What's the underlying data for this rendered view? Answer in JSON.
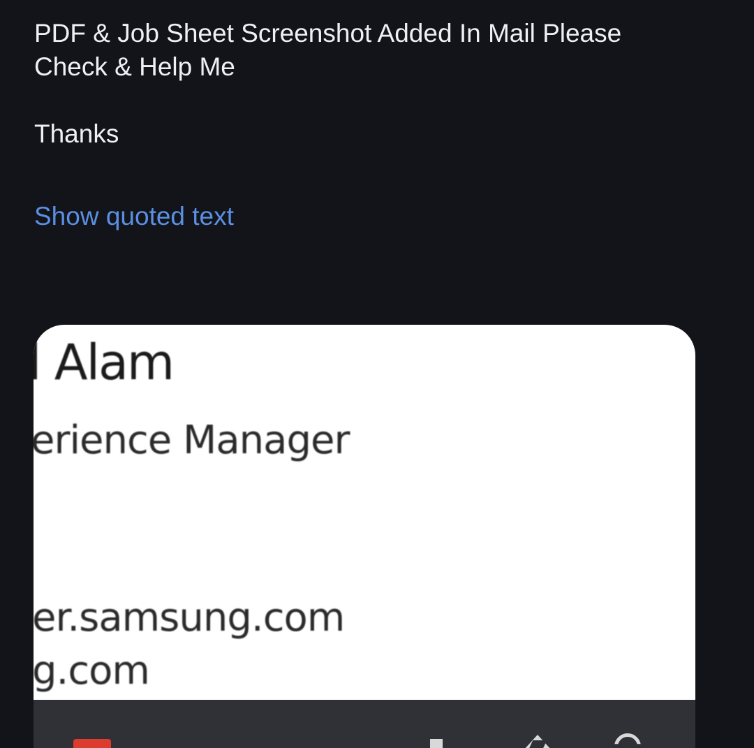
{
  "message": {
    "body_line_1": "PDF & Job Sheet Screenshot Added In Mail Please",
    "body_line_2": "Check & Help Me",
    "signoff": "Thanks",
    "show_quoted_text": "Show quoted text"
  },
  "attachment_preview": {
    "name_fragment": "l Alam",
    "title_fragment": "erience Manager",
    "website_fragment": "er.samsung.com",
    "email_fragment": "g.com"
  },
  "attachment_actions": {
    "file_icon": "pdf-file-icon",
    "download_icon": "download-icon",
    "drive_icon": "drive-icon",
    "photos_icon": "photos-icon"
  },
  "colors": {
    "background": "#131419",
    "link": "#5a8fe3",
    "card": "#ffffff",
    "action_bar": "#303136",
    "pdf_badge": "#dc3b30"
  }
}
